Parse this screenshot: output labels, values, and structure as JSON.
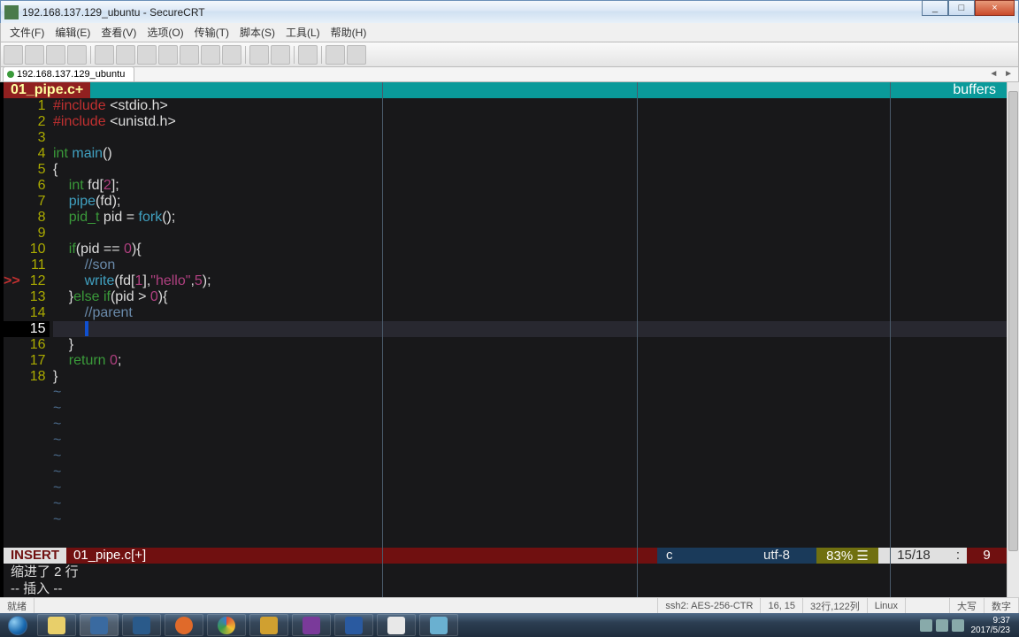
{
  "window": {
    "title": "192.168.137.129_ubuntu - SecureCRT",
    "minimize": "_",
    "maximize": "□",
    "close": "×"
  },
  "menu": {
    "file": "文件(F)",
    "edit": "编辑(E)",
    "view": "查看(V)",
    "options": "选项(O)",
    "transfer": "传输(T)",
    "script": "脚本(S)",
    "tools": "工具(L)",
    "help": "帮助(H)"
  },
  "tab": {
    "label": "192.168.137.129_ubuntu",
    "arrows": "◄ ►"
  },
  "editor": {
    "filename_tab": "01_pipe.c+",
    "buffers_label": "buffers",
    "lines": [
      {
        "n": 1,
        "html": "<span class='pp'>#include</span> <span class='op'>&lt;stdio.h&gt;</span>"
      },
      {
        "n": 2,
        "html": "<span class='pp'>#include</span> <span class='op'>&lt;unistd.h&gt;</span>"
      },
      {
        "n": 3,
        "html": ""
      },
      {
        "n": 4,
        "html": "<span class='ty'>int</span> <span class='id'>main</span>()"
      },
      {
        "n": 5,
        "html": "{"
      },
      {
        "n": 6,
        "html": "    <span class='ty'>int</span> fd[<span class='num'>2</span>];"
      },
      {
        "n": 7,
        "html": "    <span class='id'>pipe</span>(fd);"
      },
      {
        "n": 8,
        "html": "    <span class='ty'>pid_t</span> pid = <span class='id'>fork</span>();"
      },
      {
        "n": 9,
        "html": ""
      },
      {
        "n": 10,
        "html": "    <span class='kw'>if</span>(pid == <span class='num'>0</span>){"
      },
      {
        "n": 11,
        "html": "        <span class='cm'>//son</span>"
      },
      {
        "n": 12,
        "html": "        <span class='id'>write</span>(fd[<span class='num'>1</span>],<span class='str'>\"hello\"</span>,<span class='num'>5</span>);",
        "mark": ">>"
      },
      {
        "n": 13,
        "html": "    }<span class='kw'>else</span> <span class='kw'>if</span>(pid &gt; <span class='num'>0</span>){"
      },
      {
        "n": 14,
        "html": "        <span class='cm'>//parent</span>"
      },
      {
        "n": 15,
        "html": "        <span class='cursor'> </span>",
        "current": true
      },
      {
        "n": 16,
        "html": "    }"
      },
      {
        "n": 17,
        "html": "    <span class='kw'>return</span> <span class='num'>0</span>;"
      },
      {
        "n": 18,
        "html": "}"
      }
    ],
    "status": {
      "mode": "INSERT",
      "file": "01_pipe.c[+]",
      "filetype": "c",
      "encoding": "utf-8",
      "percent": "83% ☰",
      "position": "15/18",
      "sep": ":",
      "col": "9"
    },
    "msg1": "缩进了 2 行",
    "msg2": "-- 插入 --"
  },
  "crtbar": {
    "ready": "就绪",
    "ssh": "ssh2: AES-256-CTR",
    "cursor": "16, 15",
    "size": "32行,122列",
    "os": "Linux",
    "caps": "大写",
    "num": "数字"
  },
  "tray": {
    "time": "9:37",
    "date": "2017/5/23"
  }
}
